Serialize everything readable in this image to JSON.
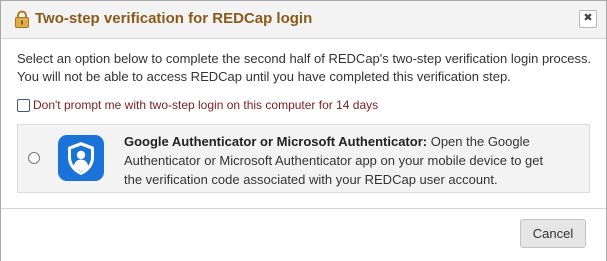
{
  "dialog": {
    "title": "Two-step verification for REDCap login",
    "title_icon": "lock-icon",
    "close_label": "✖",
    "instructions": [
      "Select an option below to complete the second half of REDCap's two-step verification login process.",
      "You will not be able to access REDCap until you have completed this verification step."
    ],
    "dont_prompt": {
      "label": "Don't prompt me with two-step login on this computer for 14 days",
      "checked": false
    },
    "options": [
      {
        "icon": "microsoft-authenticator-icon",
        "title": "Google Authenticator or Microsoft Authenticator:",
        "description": "Open the Google Authenticator or Microsoft Authenticator app on your mobile device to get the verification code associated with your REDCap user account.",
        "selected": false
      }
    ],
    "cancel_label": "Cancel"
  },
  "colors": {
    "title": "#8a5a1a",
    "checkbox_label": "#7a1f1f",
    "authenticator_blue": "#1a73d9",
    "lock_gold": "#d9a441"
  }
}
